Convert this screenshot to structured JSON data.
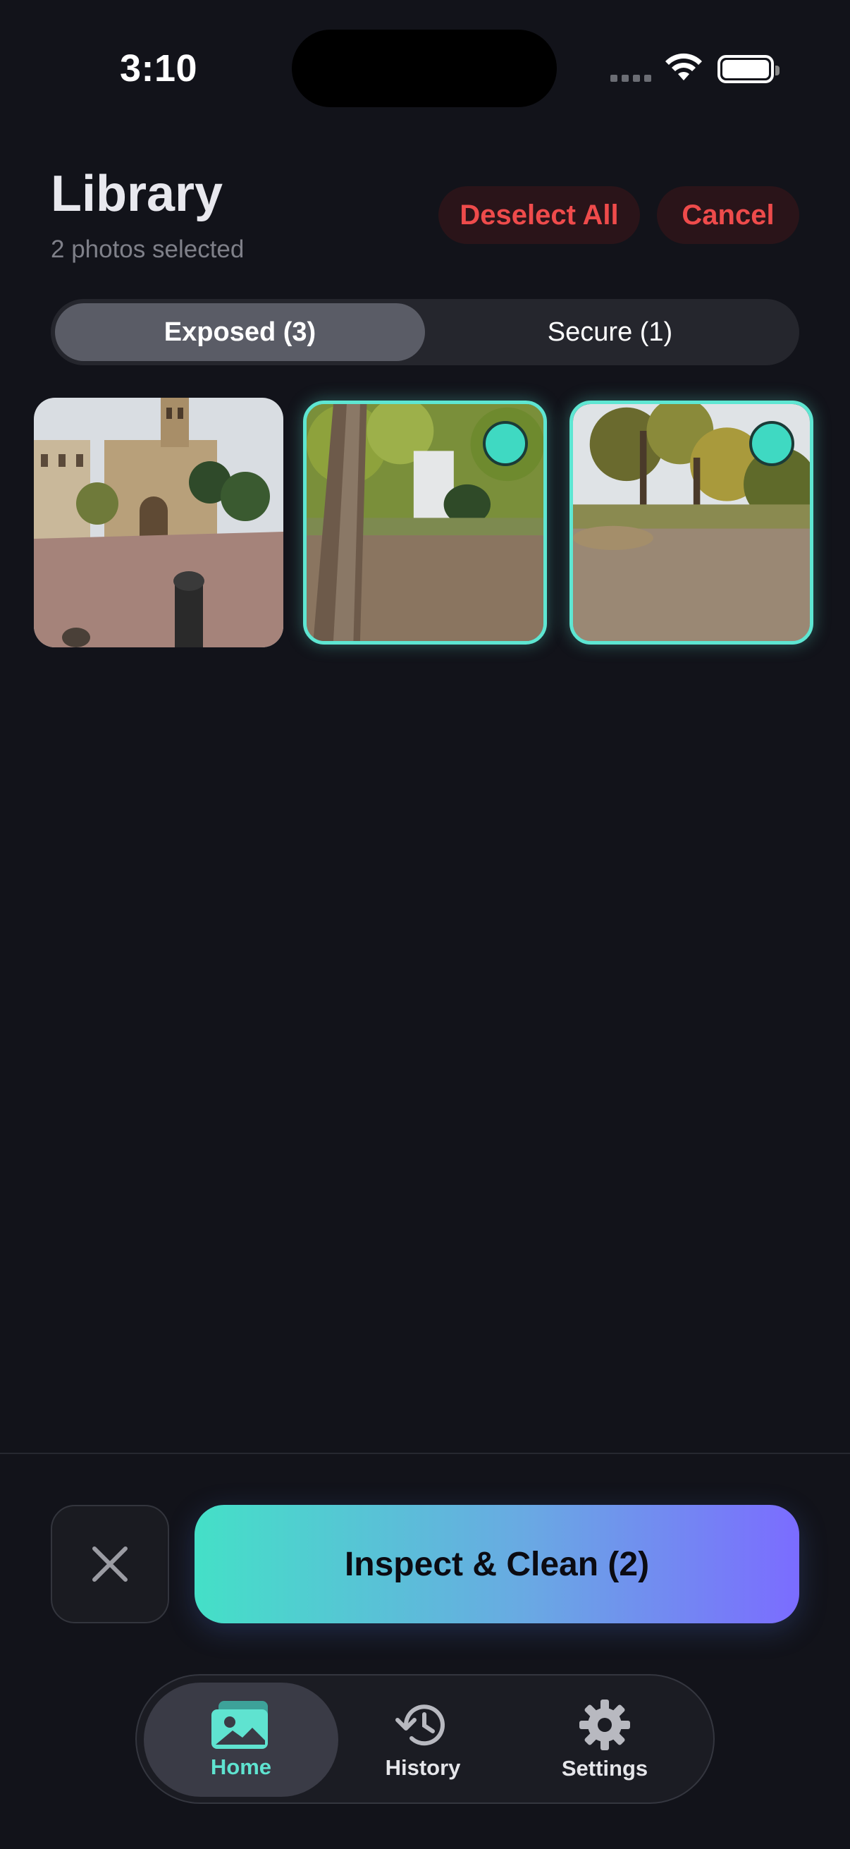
{
  "status_bar": {
    "time": "3:10"
  },
  "header": {
    "title": "Library",
    "subtitle": "2 photos selected",
    "deselect_label": "Deselect All",
    "cancel_label": "Cancel"
  },
  "segment": {
    "tabs": [
      {
        "label": "Exposed (3)",
        "active": true
      },
      {
        "label": "Secure (1)",
        "active": false
      }
    ]
  },
  "photos": [
    {
      "selected": false
    },
    {
      "selected": true
    },
    {
      "selected": true
    }
  ],
  "actions": {
    "cta_label": "Inspect & Clean (2)"
  },
  "tabbar": {
    "items": [
      {
        "label": "Home",
        "icon": "photos-icon",
        "active": true
      },
      {
        "label": "History",
        "icon": "history-icon",
        "active": false
      },
      {
        "label": "Settings",
        "icon": "gear-icon",
        "active": false
      }
    ]
  },
  "colors": {
    "accent": "#5ee6d2",
    "danger": "#ee4b4b",
    "background": "#12131a",
    "gradient_start": "#44e0c7",
    "gradient_end": "#7b6cff"
  }
}
